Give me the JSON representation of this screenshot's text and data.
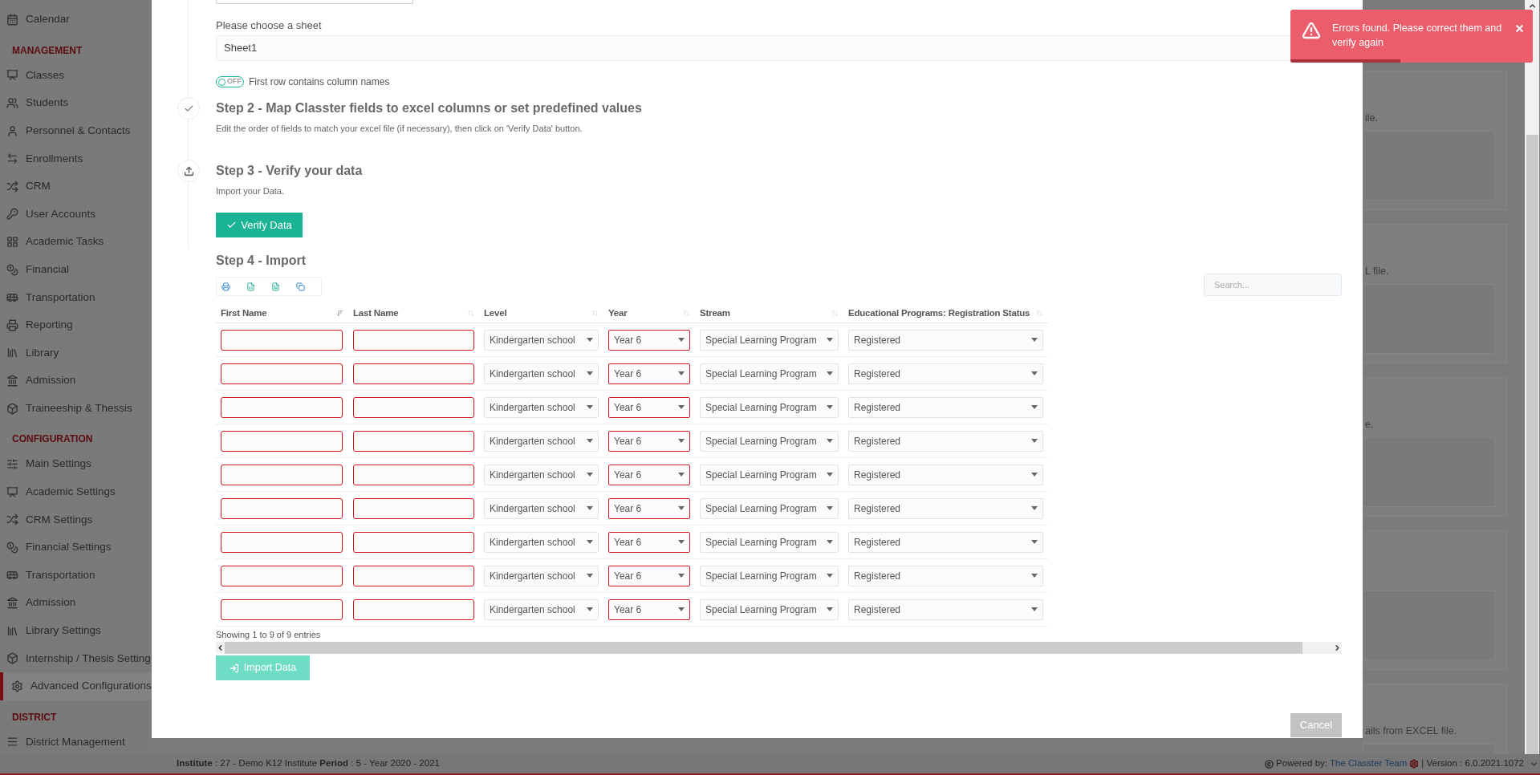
{
  "sidebar": {
    "sections": [
      {
        "items": [
          {
            "label": "Calendar",
            "selected": false
          }
        ]
      },
      {
        "heading": "MANAGEMENT",
        "items": [
          {
            "label": "Classes",
            "selected": false
          },
          {
            "label": "Students",
            "selected": false
          },
          {
            "label": "Personnel & Contacts",
            "selected": false
          },
          {
            "label": "Enrollments",
            "selected": false
          },
          {
            "label": "CRM",
            "selected": false
          },
          {
            "label": "User Accounts",
            "selected": false
          },
          {
            "label": "Academic Tasks",
            "selected": false
          },
          {
            "label": "Financial",
            "selected": false
          },
          {
            "label": "Transportation",
            "selected": false
          },
          {
            "label": "Reporting",
            "selected": false
          },
          {
            "label": "Library",
            "selected": false
          },
          {
            "label": "Admission",
            "selected": false
          },
          {
            "label": "Traineeship & Thessis",
            "selected": false
          }
        ]
      },
      {
        "heading": "CONFIGURATION",
        "items": [
          {
            "label": "Main Settings",
            "selected": false
          },
          {
            "label": "Academic Settings",
            "selected": false
          },
          {
            "label": "CRM Settings",
            "selected": false
          },
          {
            "label": "Financial Settings",
            "selected": false
          },
          {
            "label": "Transportation",
            "selected": false
          },
          {
            "label": "Admission",
            "selected": false
          },
          {
            "label": "Library Settings",
            "selected": false
          },
          {
            "label": "Internship / Thesis Setting",
            "selected": false
          },
          {
            "label": "Advanced Configurations",
            "selected": true
          }
        ]
      },
      {
        "heading": "DISTRICT",
        "items": [
          {
            "label": "District Management",
            "selected": false
          }
        ]
      }
    ]
  },
  "modal": {
    "sheet": {
      "label": "Please choose a sheet",
      "value": "Sheet1"
    },
    "toggle": {
      "text": "OFF",
      "on": false,
      "label": "First row contains column names"
    },
    "steps": [
      {
        "title": "Step 2 - Map Classter fields to excel columns or set predefined values",
        "description": "Edit the order of fields to match your excel file (if necessary), then click on 'Verify Data' button.",
        "kind": "check"
      },
      {
        "title": "Step 3 - Verify your data",
        "description": "Import your Data.",
        "kind": "upload"
      }
    ],
    "verify_button": "Verify Data",
    "import_title": "Step 4 - Import",
    "search": {
      "placeholder": "Search..."
    },
    "table": {
      "columns": [
        {
          "label": "First Name",
          "sorted": true
        },
        {
          "label": "Last Name",
          "sorted": false
        },
        {
          "label": "Level",
          "sorted": false
        },
        {
          "label": "Year",
          "sorted": false
        },
        {
          "label": "Stream",
          "sorted": false
        },
        {
          "label": "Educational Programs: Registration Status",
          "sorted": false
        }
      ],
      "rows": [
        [
          {
            "kind": "input",
            "error": true
          },
          {
            "kind": "input",
            "error": true
          },
          {
            "kind": "select",
            "value": "Kindergarten school",
            "error": false
          },
          {
            "kind": "select",
            "value": "Year 6",
            "error": true
          },
          {
            "kind": "select",
            "value": "Special Learning Program",
            "error": false
          },
          {
            "kind": "select",
            "value": "Registered",
            "error": false
          }
        ],
        [
          {
            "kind": "input",
            "error": true
          },
          {
            "kind": "input",
            "error": true
          },
          {
            "kind": "select",
            "value": "Kindergarten school",
            "error": false
          },
          {
            "kind": "select",
            "value": "Year 6",
            "error": true
          },
          {
            "kind": "select",
            "value": "Special Learning Program",
            "error": false
          },
          {
            "kind": "select",
            "value": "Registered",
            "error": false
          }
        ],
        [
          {
            "kind": "input",
            "error": true
          },
          {
            "kind": "input",
            "error": true
          },
          {
            "kind": "select",
            "value": "Kindergarten school",
            "error": false
          },
          {
            "kind": "select",
            "value": "Year 6",
            "error": true
          },
          {
            "kind": "select",
            "value": "Special Learning Program",
            "error": false
          },
          {
            "kind": "select",
            "value": "Registered",
            "error": false
          }
        ],
        [
          {
            "kind": "input",
            "error": true
          },
          {
            "kind": "input",
            "error": true
          },
          {
            "kind": "select",
            "value": "Kindergarten school",
            "error": false
          },
          {
            "kind": "select",
            "value": "Year 6",
            "error": true
          },
          {
            "kind": "select",
            "value": "Special Learning Program",
            "error": false
          },
          {
            "kind": "select",
            "value": "Registered",
            "error": false
          }
        ],
        [
          {
            "kind": "input",
            "error": true
          },
          {
            "kind": "input",
            "error": true
          },
          {
            "kind": "select",
            "value": "Kindergarten school",
            "error": false
          },
          {
            "kind": "select",
            "value": "Year 6",
            "error": true
          },
          {
            "kind": "select",
            "value": "Special Learning Program",
            "error": false
          },
          {
            "kind": "select",
            "value": "Registered",
            "error": false
          }
        ],
        [
          {
            "kind": "input",
            "error": true
          },
          {
            "kind": "input",
            "error": true
          },
          {
            "kind": "select",
            "value": "Kindergarten school",
            "error": false
          },
          {
            "kind": "select",
            "value": "Year 6",
            "error": true
          },
          {
            "kind": "select",
            "value": "Special Learning Program",
            "error": false
          },
          {
            "kind": "select",
            "value": "Registered",
            "error": false
          }
        ],
        [
          {
            "kind": "input",
            "error": true
          },
          {
            "kind": "input",
            "error": true
          },
          {
            "kind": "select",
            "value": "Kindergarten school",
            "error": false
          },
          {
            "kind": "select",
            "value": "Year 6",
            "error": true
          },
          {
            "kind": "select",
            "value": "Special Learning Program",
            "error": false
          },
          {
            "kind": "select",
            "value": "Registered",
            "error": false
          }
        ],
        [
          {
            "kind": "input",
            "error": true
          },
          {
            "kind": "input",
            "error": true
          },
          {
            "kind": "select",
            "value": "Kindergarten school",
            "error": false
          },
          {
            "kind": "select",
            "value": "Year 6",
            "error": true
          },
          {
            "kind": "select",
            "value": "Special Learning Program",
            "error": false
          },
          {
            "kind": "select",
            "value": "Registered",
            "error": false
          }
        ],
        [
          {
            "kind": "input",
            "error": true
          },
          {
            "kind": "input",
            "error": true
          },
          {
            "kind": "select",
            "value": "Kindergarten school",
            "error": false
          },
          {
            "kind": "select",
            "value": "Year 6",
            "error": true
          },
          {
            "kind": "select",
            "value": "Special Learning Program",
            "error": false
          },
          {
            "kind": "select",
            "value": "Registered",
            "error": false
          }
        ]
      ]
    },
    "info": "Showing 1 to 9 of 9 entries",
    "import_button": {
      "label": "Import Data",
      "disabled": true
    },
    "cancel_button": "Cancel"
  },
  "background_cards": [
    {
      "kind": "text",
      "text": "ile."
    },
    {
      "kind": "text",
      "text": "L file."
    },
    {
      "kind": "text",
      "text": "e."
    },
    {
      "kind": "blank"
    },
    {
      "kind": "text",
      "text": "ails from EXCEL file."
    }
  ],
  "toast": {
    "message": "Errors found. Please correct them and verify again"
  },
  "footer": {
    "left": "**Institute** : 27 - Demo K12 Institute **Period** : 5 - Year 2020 - 2021",
    "powered": "Powered by:",
    "link": "The Classter Team",
    "version": "| Version : 6.0.2021.1072"
  }
}
